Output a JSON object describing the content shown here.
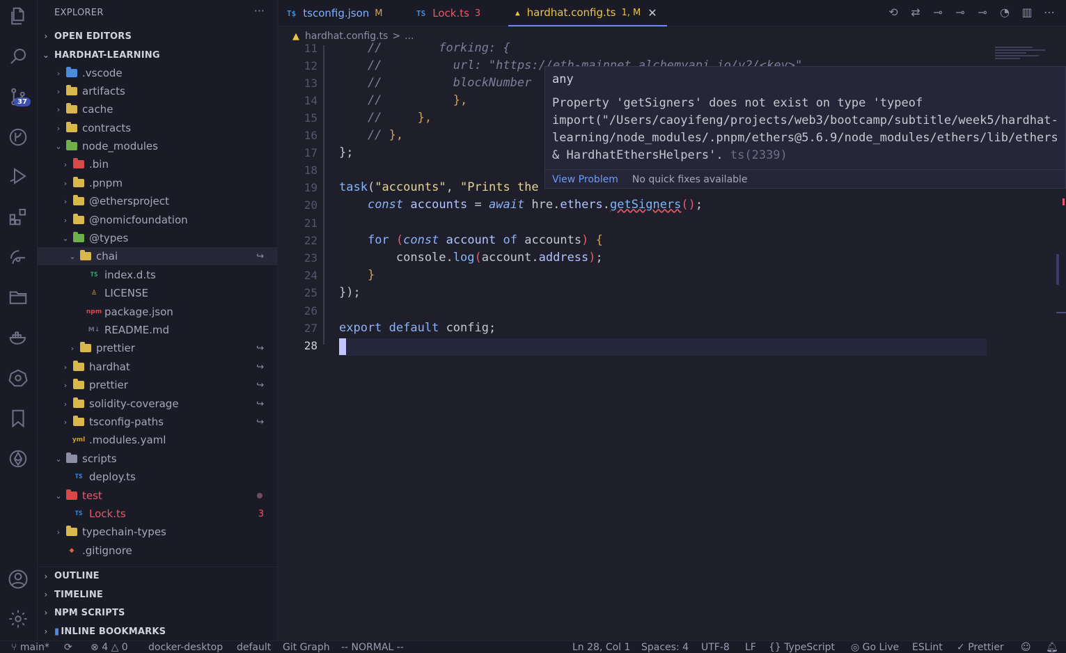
{
  "sidebar": {
    "title": "EXPLORER",
    "more": "···",
    "open_editors": "OPEN EDITORS",
    "project": "HARDHAT-LEARNING",
    "tree": [
      {
        "label": ".vscode"
      },
      {
        "label": "artifacts"
      },
      {
        "label": "cache"
      },
      {
        "label": "contracts"
      },
      {
        "label": "node_modules"
      },
      {
        "label": ".bin"
      },
      {
        "label": ".pnpm"
      },
      {
        "label": "@ethersproject"
      },
      {
        "label": "@nomicfoundation"
      },
      {
        "label": "@types"
      },
      {
        "label": "chai"
      },
      {
        "label": "index.d.ts"
      },
      {
        "label": "LICENSE"
      },
      {
        "label": "package.json"
      },
      {
        "label": "README.md"
      },
      {
        "label": "prettier"
      },
      {
        "label": "hardhat"
      },
      {
        "label": "prettier"
      },
      {
        "label": "solidity-coverage"
      },
      {
        "label": "tsconfig-paths"
      },
      {
        "label": ".modules.yaml"
      },
      {
        "label": "scripts"
      },
      {
        "label": "deploy.ts"
      },
      {
        "label": "test"
      },
      {
        "label": "Lock.ts",
        "badge": "3"
      },
      {
        "label": "typechain-types"
      },
      {
        "label": ".gitignore"
      }
    ],
    "sections": {
      "outline": "OUTLINE",
      "timeline": "TIMELINE",
      "npm_scripts": "NPM SCRIPTS",
      "inline_bookmarks": "INLINE BOOKMARKS"
    }
  },
  "activity": {
    "scm_badge": "37"
  },
  "tabs": [
    {
      "label": "tsconfig.json",
      "mark": "M",
      "icon": "TS"
    },
    {
      "label": "Lock.ts",
      "mark": "3",
      "icon": "TS"
    },
    {
      "label": "hardhat.config.ts",
      "mark": "1, M",
      "icon": "warning"
    }
  ],
  "breadcrumb": {
    "file": "hardhat.config.ts",
    "sep": ">",
    "rest": "..."
  },
  "editor": {
    "line_numbers": [
      "11",
      "12",
      "13",
      "14",
      "15",
      "16",
      "17",
      "18",
      "19",
      "20",
      "21",
      "22",
      "23",
      "24",
      "25",
      "26",
      "27",
      "28"
    ],
    "current_line": "28"
  },
  "hover": {
    "type": "any",
    "message_lines": [
      "Property 'getSigners' does not exist on type 'typeof",
      "import(\"/Users/caoyifeng/projects/web3/bootcamp/subtitle/week5/hardhat-",
      "learning/node_modules/.pnpm/ethers@5.6.9/node_modules/ethers/lib/ethers",
      "& HardhatEthersHelpers'."
    ],
    "code": "ts(2339)",
    "view_problem": "View Problem",
    "no_fixes": "No quick fixes available"
  },
  "status": {
    "branch": "main*",
    "errors": "4",
    "warnings": "0",
    "docker": "docker-desktop",
    "namespace": "default",
    "git_graph": "Git Graph",
    "vim_mode": "-- NORMAL --",
    "position": "Ln 28, Col 1",
    "spaces": "Spaces: 4",
    "encoding": "UTF-8",
    "eol": "LF",
    "language": "TypeScript",
    "go_live": "Go Live",
    "eslint": "ESLint",
    "prettier": "Prettier"
  },
  "colors": {
    "accent": "#6b8cff",
    "error": "#e55b6a",
    "warning": "#e8c547",
    "background": "#1e1f2b"
  }
}
